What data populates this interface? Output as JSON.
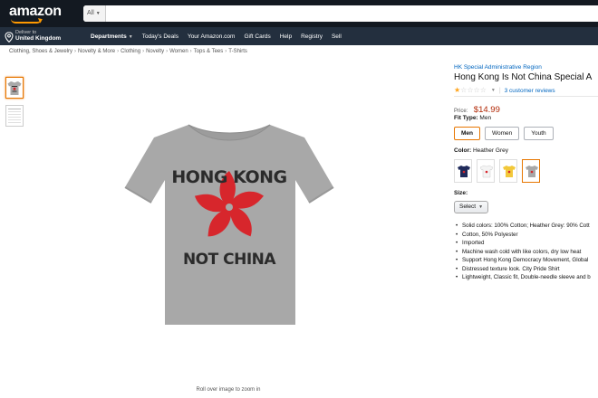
{
  "header": {
    "logo_text": "amazon",
    "search": {
      "dept_label": "All",
      "placeholder": "",
      "value": ""
    },
    "deliver": {
      "line1": "Deliver to",
      "line2": "United Kingdom"
    },
    "nav": {
      "departments": "Departments",
      "links": [
        "Today's Deals",
        "Your Amazon.com",
        "Gift Cards",
        "Help",
        "Registry",
        "Sell"
      ]
    }
  },
  "breadcrumb": [
    "Clothing, Shoes & Jewelry",
    "Novelty & More",
    "Clothing",
    "Novelty",
    "Women",
    "Tops & Tees",
    "T-Shirts"
  ],
  "gallery": {
    "zoom_hint": "Roll over image to zoom in",
    "shirt_text_top": "HONG KONG",
    "shirt_text_bottom": "NOT CHINA"
  },
  "product": {
    "brand": "HK Special Administrative Region",
    "title": "Hong Kong Is Not China Special A",
    "rating": 1,
    "rating_max": 5,
    "reviews_text": "3 customer reviews",
    "price_label": "Price:",
    "price": "$14.99",
    "fit_type_label": "Fit Type:",
    "fit_type_value": "Men",
    "fit_options": [
      "Men",
      "Women",
      "Youth"
    ],
    "color_label": "Color:",
    "color_value": "Heather Grey",
    "colors": [
      {
        "name": "navy",
        "hex": "#1f2a5a"
      },
      {
        "name": "white",
        "hex": "#f4f4f4"
      },
      {
        "name": "yellow",
        "hex": "#f2c83a"
      },
      {
        "name": "heather grey",
        "hex": "#a8a8a8"
      }
    ],
    "size_label": "Size:",
    "size_select": "Select",
    "bullets": [
      "Solid colors: 100% Cotton; Heather Grey: 90% Cott",
      "Cotton, 50% Polyester",
      "Imported",
      "Machine wash cold with like colors, dry low heat",
      "Support Hong Kong Democracy Movement, Global",
      "Distressed texture look. City Pride Shirt",
      "Lightweight, Classic fit, Double-needle sleeve and b"
    ]
  },
  "colors": {
    "header_bg": "#131921",
    "nav_bg": "#232f3e",
    "accent": "#ff9900",
    "link": "#0066c0",
    "price": "#b12704",
    "selected_border": "#e77600",
    "flag_red": "#d7262c"
  }
}
